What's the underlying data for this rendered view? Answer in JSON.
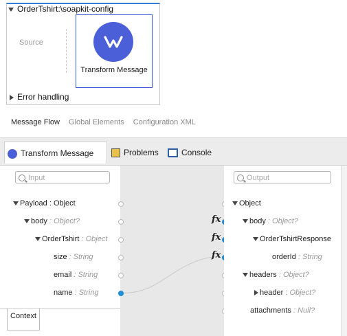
{
  "flow": {
    "title": "OrderTshirt:\\soapkit-config",
    "source_label": "Source",
    "transform_label": "Transform Message",
    "error_handling": "Error handling"
  },
  "editor_tabs": [
    {
      "label": "Message Flow",
      "active": true
    },
    {
      "label": "Global Elements",
      "active": false
    },
    {
      "label": "Configuration XML",
      "active": false
    }
  ],
  "panel_tabs": {
    "transform": "Transform Message",
    "problems": "Problems",
    "console": "Console"
  },
  "input": {
    "placeholder": "Input",
    "tree": [
      {
        "key": "Payload",
        "type": "Object"
      },
      {
        "key": "body",
        "type": "Object?"
      },
      {
        "key": "OrderTshirt",
        "type": "Object"
      },
      {
        "key": "size",
        "type": "String"
      },
      {
        "key": "email",
        "type": "String"
      },
      {
        "key": "name",
        "type": "String"
      }
    ],
    "context_tab": "Context"
  },
  "output": {
    "placeholder": "Output",
    "tree": [
      {
        "key": "Object",
        "type": ""
      },
      {
        "key": "body",
        "type": "Object?"
      },
      {
        "key": "OrderTshirtResponse",
        "type": ""
      },
      {
        "key": "orderId",
        "type": "String"
      },
      {
        "key": "headers",
        "type": "Object?"
      },
      {
        "key": "header",
        "type": "Object?"
      },
      {
        "key": "attachments",
        "type": "Null?"
      }
    ]
  },
  "mapping": {
    "fx_label": "fx"
  },
  "colors": {
    "accent": "#4b5fd8",
    "connector": "#1f8fd8"
  }
}
